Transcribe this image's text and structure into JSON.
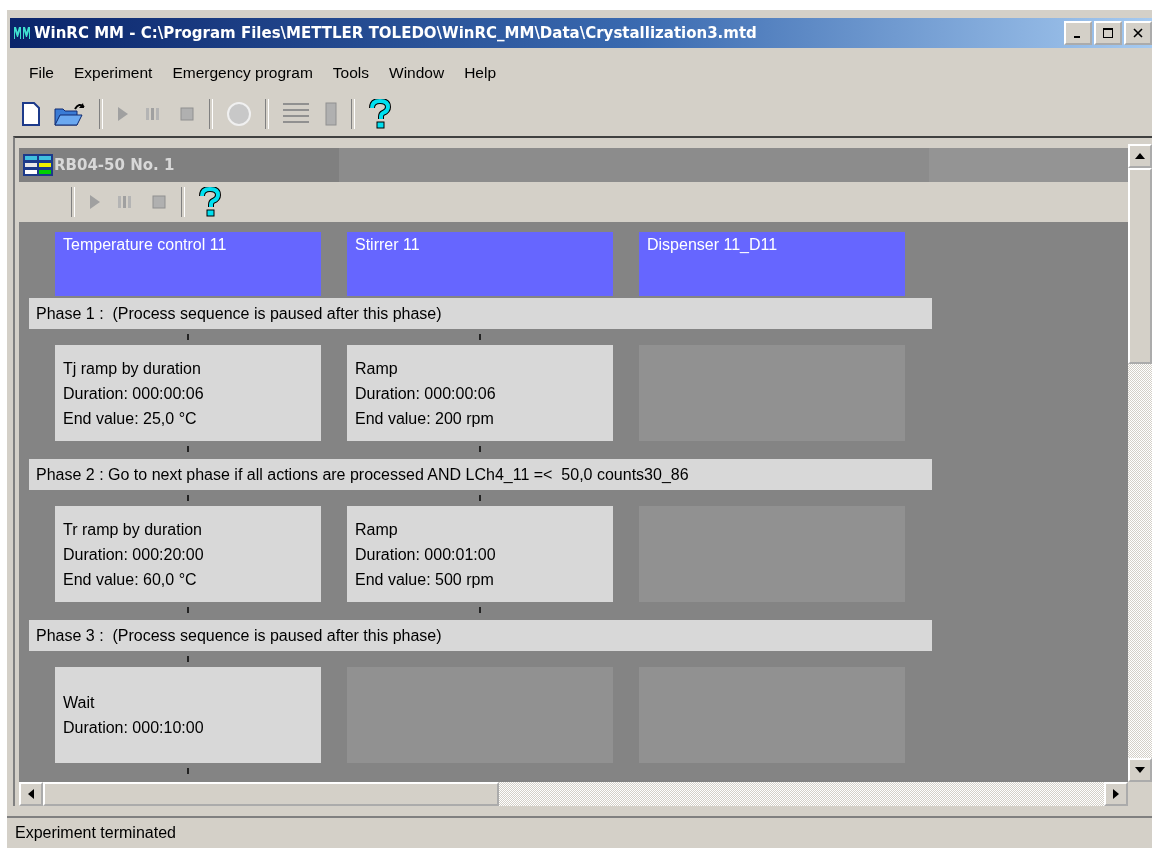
{
  "window": {
    "title": "WinRC MM - C:\\Program Files\\METTLER TOLEDO\\WinRC_MM\\Data\\Crystallization3.mtd"
  },
  "menu": [
    "File",
    "Experiment",
    "Emergency program",
    "Tools",
    "Window",
    "Help"
  ],
  "child_window": {
    "title": "RB04-50 No. 1"
  },
  "columns": [
    "Temperature control 11",
    "Stirrer 11",
    "Dispenser 11_D11"
  ],
  "phases": [
    {
      "label": "Phase 1 :  (Process sequence is paused after this phase)",
      "actions": [
        {
          "kind": "action",
          "lines": [
            "Tj ramp by duration",
            "Duration: 000:00:06",
            "End value: 25,0 °C"
          ]
        },
        {
          "kind": "action",
          "lines": [
            "Ramp",
            "Duration: 000:00:06",
            "End value: 200 rpm"
          ]
        },
        {
          "kind": "empty"
        }
      ]
    },
    {
      "label": "Phase 2 : Go to next phase if all actions are processed AND LCh4_11 =<  50,0 counts30_86",
      "actions": [
        {
          "kind": "action",
          "lines": [
            "Tr ramp by duration",
            "Duration: 000:20:00",
            "End value: 60,0 °C"
          ]
        },
        {
          "kind": "action",
          "lines": [
            "Ramp",
            "Duration: 000:01:00",
            "End value: 500 rpm"
          ]
        },
        {
          "kind": "empty"
        }
      ]
    },
    {
      "label": "Phase 3 :  (Process sequence is paused after this phase)",
      "actions": [
        {
          "kind": "action",
          "lines": [
            "Wait",
            "Duration: 000:10:00"
          ]
        },
        {
          "kind": "empty"
        },
        {
          "kind": "empty"
        }
      ]
    }
  ],
  "status_bar": "Experiment terminated"
}
